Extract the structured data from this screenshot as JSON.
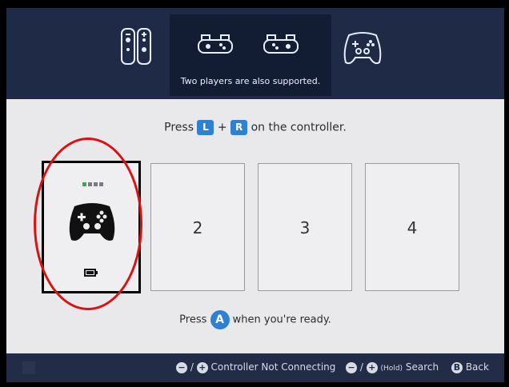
{
  "tip": {
    "text": "Two players are also supported."
  },
  "main": {
    "press_lr": {
      "prefix": "Press",
      "key_l": "L",
      "plus": "+",
      "key_r": "R",
      "suffix": "on the controller."
    },
    "slots": [
      {
        "number": ""
      },
      {
        "number": "2"
      },
      {
        "number": "3"
      },
      {
        "number": "4"
      }
    ],
    "press_a": {
      "prefix": "Press",
      "key": "A",
      "suffix": "when you're ready."
    }
  },
  "bottom": {
    "not_connecting": {
      "minus": "−",
      "slash": "/",
      "plus": "+",
      "label": "Controller Not Connecting"
    },
    "search": {
      "minus": "−",
      "slash": "/",
      "plus": "+",
      "hold": "(Hold)",
      "label": "Search"
    },
    "back": {
      "key": "B",
      "label": "Back"
    }
  }
}
